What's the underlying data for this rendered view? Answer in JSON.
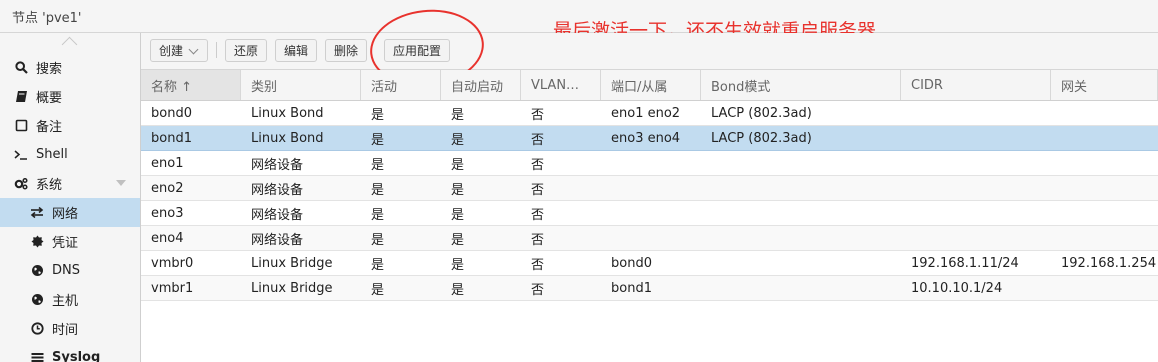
{
  "window": {
    "title": "节点 'pve1'"
  },
  "annotation": {
    "text": "最后激活一下，还不生效就重启服务器",
    "color": "#e8322d"
  },
  "sidebar": {
    "items": [
      {
        "label": "搜索",
        "icon": "search-icon"
      },
      {
        "label": "概要",
        "icon": "book-icon"
      },
      {
        "label": "备注",
        "icon": "note-icon"
      },
      {
        "label": "Shell",
        "icon": "terminal-icon"
      },
      {
        "label": "系统",
        "icon": "gears-icon"
      },
      {
        "label": "网络",
        "icon": "exchange-icon",
        "selected": true
      },
      {
        "label": "凭证",
        "icon": "certificate-icon"
      },
      {
        "label": "DNS",
        "icon": "globe-icon"
      },
      {
        "label": "主机",
        "icon": "globe-icon"
      },
      {
        "label": "时间",
        "icon": "clock-icon"
      },
      {
        "label": "Syslog",
        "icon": "list-icon"
      }
    ]
  },
  "toolbar": {
    "create": "创建",
    "revert": "还原",
    "edit": "编辑",
    "remove": "删除",
    "apply": "应用配置"
  },
  "table": {
    "columns": [
      "名称 ↑",
      "类别",
      "活动",
      "自动启动",
      "VLAN…",
      "端口/从属",
      "Bond模式",
      "CIDR",
      "网关"
    ],
    "rows": [
      [
        "bond0",
        "Linux Bond",
        "是",
        "是",
        "否",
        "eno1 eno2",
        "LACP (802.3ad)",
        "",
        ""
      ],
      [
        "bond1",
        "Linux Bond",
        "是",
        "是",
        "否",
        "eno3 eno4",
        "LACP (802.3ad)",
        "",
        ""
      ],
      [
        "eno1",
        "网络设备",
        "是",
        "是",
        "否",
        "",
        "",
        "",
        ""
      ],
      [
        "eno2",
        "网络设备",
        "是",
        "是",
        "否",
        "",
        "",
        "",
        ""
      ],
      [
        "eno3",
        "网络设备",
        "是",
        "是",
        "否",
        "",
        "",
        "",
        ""
      ],
      [
        "eno4",
        "网络设备",
        "是",
        "是",
        "否",
        "",
        "",
        "",
        ""
      ],
      [
        "vmbr0",
        "Linux Bridge",
        "是",
        "是",
        "否",
        "bond0",
        "",
        "192.168.1.11/24",
        "192.168.1.254"
      ],
      [
        "vmbr1",
        "Linux Bridge",
        "是",
        "是",
        "否",
        "bond1",
        "",
        "10.10.10.1/24",
        ""
      ]
    ],
    "selected_row": 1
  }
}
